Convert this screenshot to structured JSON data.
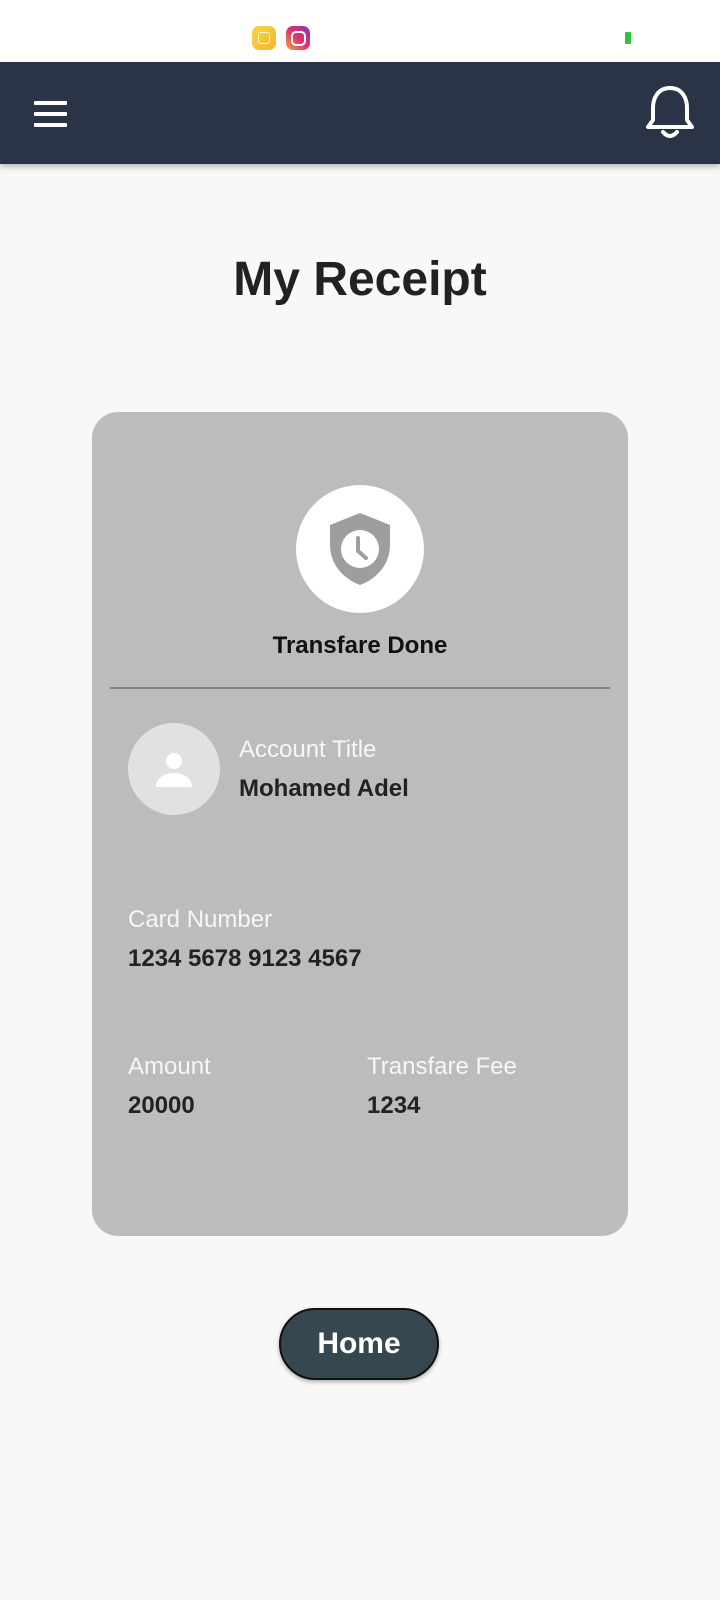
{
  "status_bar": {
    "icons": [
      "notification-app-icon",
      "instagram-icon",
      "battery-icon"
    ],
    "battery_color": "#36c13a"
  },
  "app_bar": {
    "background": "#2b3447",
    "left_icon": "menu-icon",
    "right_icon": "bell-icon"
  },
  "page": {
    "title": "My Receipt"
  },
  "receipt": {
    "card_color": "#bcbcbc",
    "status_icon": "shield-clock-icon",
    "status_text": "Transfare Done",
    "avatar_icon": "person-icon",
    "account_title_label": "Account Title",
    "account_title_value": "Mohamed Adel",
    "card_number_label": "Card Number",
    "card_number_value": "1234 5678 9123 4567",
    "amount_label": "Amount",
    "amount_value": "20000",
    "fee_label": "Transfare Fee",
    "fee_value": "1234"
  },
  "actions": {
    "home_label": "Home",
    "home_color": "#36474f"
  }
}
